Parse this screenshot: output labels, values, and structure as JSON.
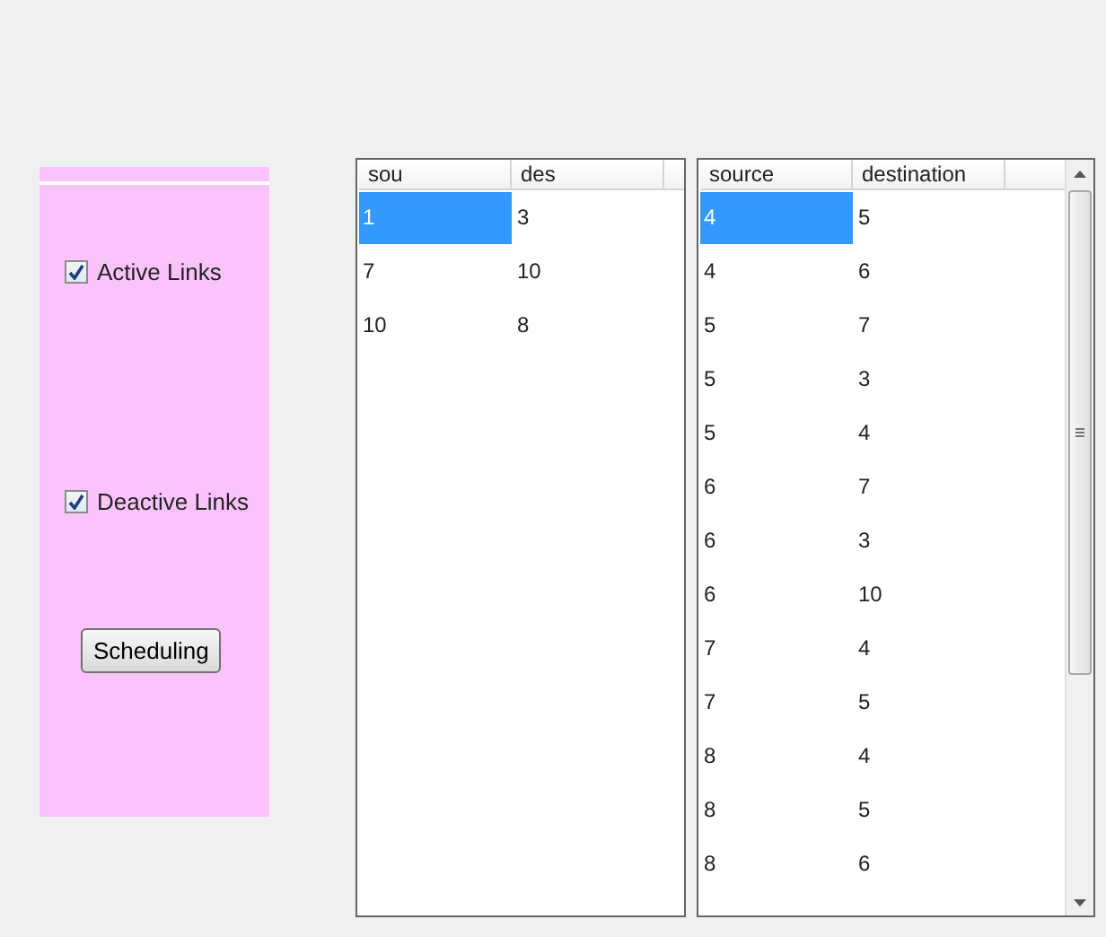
{
  "options": [
    {
      "label": "Active Links",
      "checked": true
    },
    {
      "label": "Deactive Links",
      "checked": true
    }
  ],
  "scheduling_button": "Scheduling",
  "tables": [
    {
      "columns": [
        "sou",
        "des"
      ],
      "scrollbar": false,
      "rows": [
        {
          "cells": [
            "1",
            "3"
          ],
          "selected": true
        },
        {
          "cells": [
            "7",
            "10"
          ],
          "selected": false
        },
        {
          "cells": [
            "10",
            "8"
          ],
          "selected": false
        }
      ]
    },
    {
      "columns": [
        "source",
        "destination"
      ],
      "scrollbar": true,
      "rows": [
        {
          "cells": [
            "4",
            "5"
          ],
          "selected": true
        },
        {
          "cells": [
            "4",
            "6"
          ],
          "selected": false
        },
        {
          "cells": [
            "5",
            "7"
          ],
          "selected": false
        },
        {
          "cells": [
            "5",
            "3"
          ],
          "selected": false
        },
        {
          "cells": [
            "5",
            "4"
          ],
          "selected": false
        },
        {
          "cells": [
            "6",
            "7"
          ],
          "selected": false
        },
        {
          "cells": [
            "6",
            "3"
          ],
          "selected": false
        },
        {
          "cells": [
            "6",
            "10"
          ],
          "selected": false
        },
        {
          "cells": [
            "7",
            "4"
          ],
          "selected": false
        },
        {
          "cells": [
            "7",
            "5"
          ],
          "selected": false
        },
        {
          "cells": [
            "8",
            "4"
          ],
          "selected": false
        },
        {
          "cells": [
            "8",
            "5"
          ],
          "selected": false
        },
        {
          "cells": [
            "8",
            "6"
          ],
          "selected": false
        }
      ]
    }
  ]
}
